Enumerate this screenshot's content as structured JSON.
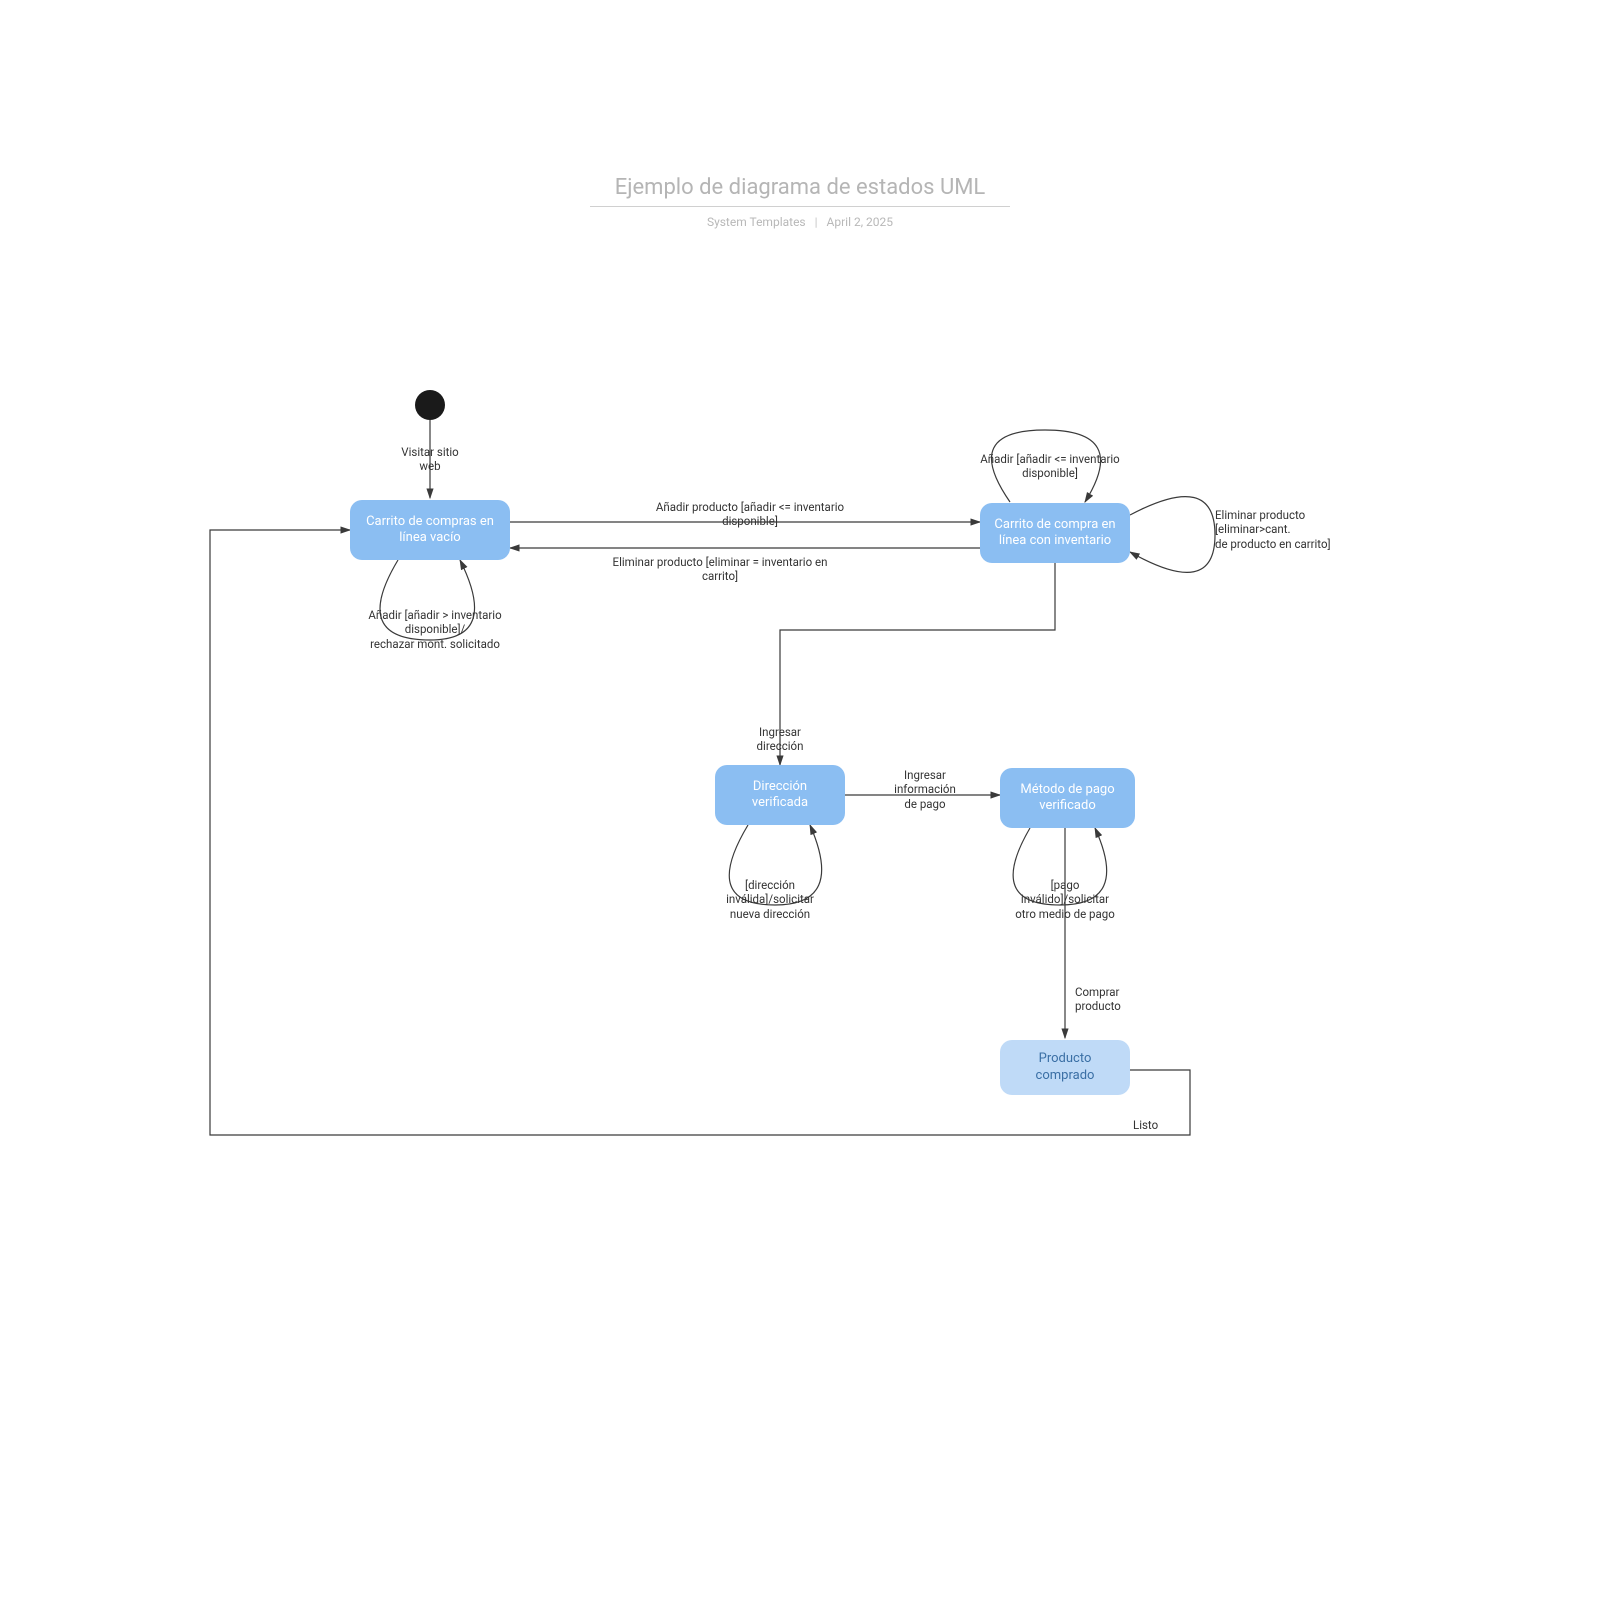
{
  "header": {
    "title": "Ejemplo de diagrama de estados UML",
    "author": "System Templates",
    "date": "April 2, 2025"
  },
  "states": {
    "start": "initial",
    "emptyCart": "Carrito de\ncompras en línea\nvacío",
    "cartWithInventory": "Carrito de compra\nen línea con\ninventario",
    "addressVerified": "Dirección\nverificada",
    "paymentVerified": "Método de pago\nverificado",
    "purchased": "Producto\ncomprado"
  },
  "transitions": {
    "visitWeb": "Visitar sitio\nweb",
    "addProduct": "Añadir producto [añadir <= inventario\ndisponible]",
    "removeProductEqInv": "Eliminar producto [eliminar = inventario en\ncarrito]",
    "addRejectSelf": "Añadir [añadir > inventario\ndisponible]/\nrechazar mont. solicitado",
    "addLeqInvSelf": "Añadir [añadir <= inventario\ndisponible]",
    "removeGtCantSelf": "Eliminar producto\n[eliminar>cant.\nde producto en carrito]",
    "enterAddress": "Ingresar\ndirección",
    "enterPaymentInfo": "Ingresar\ninformación\nde pago",
    "invalidAddress": "[dirección\ninválida]/solicitar\nnueva dirección",
    "invalidPayment": "[pago\ninválido]/solicitar\notro medio de pago",
    "buyProduct": "Comprar\nproducto",
    "done": "Listo"
  },
  "colors": {
    "stateFill": "#8bbef2",
    "stateLightFill": "#bfdaf7",
    "stroke": "#3a3a3a"
  }
}
